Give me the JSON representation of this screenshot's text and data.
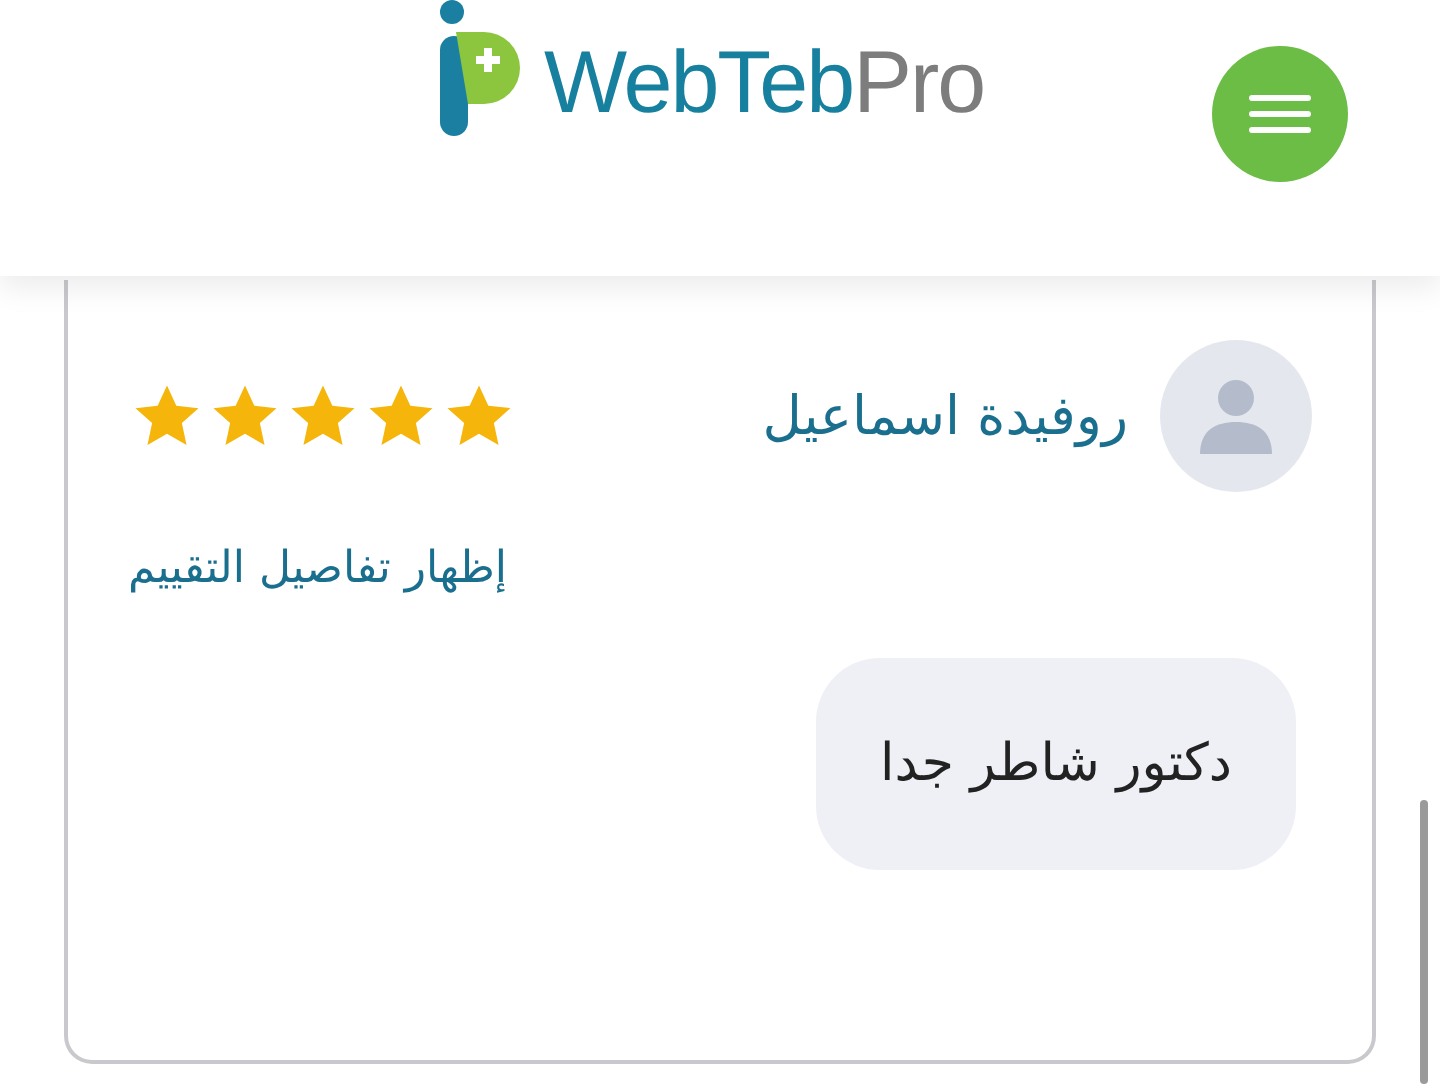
{
  "header": {
    "logo": {
      "brand": "WebTeb",
      "suffix": "Pro"
    }
  },
  "review": {
    "name": "روفيدة اسماعيل",
    "stars": 5,
    "details_link": "إظهار تفاصيل التقييم",
    "comment": "دكتور شاطر جدا"
  }
}
